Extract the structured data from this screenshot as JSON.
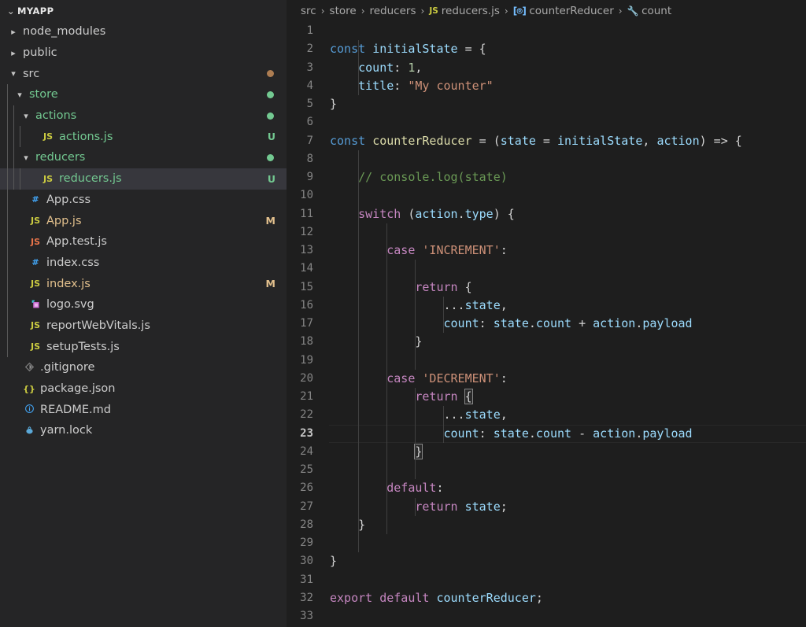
{
  "sidebar": {
    "header": {
      "label": "MYAPP",
      "twisty": "chevron-down-icon"
    },
    "items": [
      {
        "label": "node_modules",
        "indent": 1,
        "kind": "folder",
        "twisty": "collapsed",
        "icon": "",
        "icon_class": "",
        "text_class": "t-default",
        "status": "",
        "dot": ""
      },
      {
        "label": "public",
        "indent": 1,
        "kind": "folder",
        "twisty": "collapsed",
        "icon": "",
        "icon_class": "",
        "text_class": "t-default",
        "status": "",
        "dot": ""
      },
      {
        "label": "src",
        "indent": 1,
        "kind": "folder",
        "twisty": "expanded",
        "icon": "",
        "icon_class": "",
        "text_class": "t-default",
        "status": "",
        "dot": "mixed"
      },
      {
        "label": "store",
        "indent": 2,
        "kind": "folder",
        "twisty": "expanded",
        "icon": "",
        "icon_class": "",
        "text_class": "t-untracked",
        "status": "",
        "dot": "green"
      },
      {
        "label": "actions",
        "indent": 3,
        "kind": "folder",
        "twisty": "expanded",
        "icon": "",
        "icon_class": "",
        "text_class": "t-untracked",
        "status": "",
        "dot": "green"
      },
      {
        "label": "actions.js",
        "indent": 4,
        "kind": "file",
        "twisty": "none",
        "icon": "JS",
        "icon_class": "c-js",
        "text_class": "t-untracked",
        "status": "U",
        "dot": ""
      },
      {
        "label": "reducers",
        "indent": 3,
        "kind": "folder",
        "twisty": "expanded",
        "icon": "",
        "icon_class": "",
        "text_class": "t-untracked",
        "status": "",
        "dot": "green"
      },
      {
        "label": "reducers.js",
        "indent": 4,
        "kind": "file",
        "twisty": "none",
        "icon": "JS",
        "icon_class": "c-js",
        "text_class": "t-untracked",
        "status": "U",
        "dot": "",
        "selected": true
      },
      {
        "label": "App.css",
        "indent": 2,
        "kind": "file",
        "twisty": "none",
        "icon": "#",
        "icon_class": "c-css",
        "text_class": "t-default",
        "status": "",
        "dot": ""
      },
      {
        "label": "App.js",
        "indent": 2,
        "kind": "file",
        "twisty": "none",
        "icon": "JS",
        "icon_class": "c-js",
        "text_class": "t-modified",
        "status": "M",
        "dot": ""
      },
      {
        "label": "App.test.js",
        "indent": 2,
        "kind": "file",
        "twisty": "none",
        "icon": "JS",
        "icon_class": "c-jstest",
        "text_class": "t-default",
        "status": "",
        "dot": ""
      },
      {
        "label": "index.css",
        "indent": 2,
        "kind": "file",
        "twisty": "none",
        "icon": "#",
        "icon_class": "c-css",
        "text_class": "t-default",
        "status": "",
        "dot": ""
      },
      {
        "label": "index.js",
        "indent": 2,
        "kind": "file",
        "twisty": "none",
        "icon": "JS",
        "icon_class": "c-js",
        "text_class": "t-modified",
        "status": "M",
        "dot": ""
      },
      {
        "label": "logo.svg",
        "indent": 2,
        "kind": "file",
        "twisty": "none",
        "icon": "svg-icon",
        "icon_class": "c-svg",
        "text_class": "t-default",
        "status": "",
        "dot": ""
      },
      {
        "label": "reportWebVitals.js",
        "indent": 2,
        "kind": "file",
        "twisty": "none",
        "icon": "JS",
        "icon_class": "c-js",
        "text_class": "t-default",
        "status": "",
        "dot": ""
      },
      {
        "label": "setupTests.js",
        "indent": 2,
        "kind": "file",
        "twisty": "none",
        "icon": "JS",
        "icon_class": "c-js",
        "text_class": "t-default",
        "status": "",
        "dot": ""
      },
      {
        "label": ".gitignore",
        "indent": 1,
        "kind": "file",
        "twisty": "none",
        "icon": "git-icon",
        "icon_class": "c-git",
        "text_class": "t-default",
        "status": "",
        "dot": ""
      },
      {
        "label": "package.json",
        "indent": 1,
        "kind": "file",
        "twisty": "none",
        "icon": "{}",
        "icon_class": "c-json",
        "text_class": "t-default",
        "status": "",
        "dot": ""
      },
      {
        "label": "README.md",
        "indent": 1,
        "kind": "file",
        "twisty": "none",
        "icon": "info-icon",
        "icon_class": "c-md",
        "text_class": "t-default",
        "status": "",
        "dot": ""
      },
      {
        "label": "yarn.lock",
        "indent": 1,
        "kind": "file",
        "twisty": "none",
        "icon": "yarn-icon",
        "icon_class": "c-yarn",
        "text_class": "t-default",
        "status": "",
        "dot": ""
      }
    ]
  },
  "breadcrumbs": {
    "separator": "›",
    "items": [
      {
        "label": "src",
        "icon": ""
      },
      {
        "label": "store",
        "icon": ""
      },
      {
        "label": "reducers",
        "icon": ""
      },
      {
        "label": "reducers.js",
        "icon": "js-file-icon"
      },
      {
        "label": "counterReducer",
        "icon": "symbol-variable-icon"
      },
      {
        "label": "count",
        "icon": "symbol-property-icon"
      }
    ]
  },
  "editor": {
    "language": "javascript",
    "file_name": "reducers.js",
    "current_line": 23,
    "total_lines": 33,
    "lines": [
      {
        "n": 1,
        "tokens": []
      },
      {
        "n": 2,
        "tokens": [
          {
            "t": "const",
            "c": "k"
          },
          {
            "t": " ",
            "c": "pn"
          },
          {
            "t": "initialState",
            "c": "var"
          },
          {
            "t": " = {",
            "c": "pn"
          }
        ]
      },
      {
        "n": 3,
        "tokens": [
          {
            "t": "    ",
            "c": "pn"
          },
          {
            "t": "count",
            "c": "var"
          },
          {
            "t": ": ",
            "c": "pn"
          },
          {
            "t": "1",
            "c": "num"
          },
          {
            "t": ",",
            "c": "pn"
          }
        ]
      },
      {
        "n": 4,
        "tokens": [
          {
            "t": "    ",
            "c": "pn"
          },
          {
            "t": "title",
            "c": "var"
          },
          {
            "t": ": ",
            "c": "pn"
          },
          {
            "t": "\"My counter\"",
            "c": "str"
          }
        ]
      },
      {
        "n": 5,
        "tokens": [
          {
            "t": "}",
            "c": "pn"
          }
        ]
      },
      {
        "n": 6,
        "tokens": []
      },
      {
        "n": 7,
        "tokens": [
          {
            "t": "const",
            "c": "k"
          },
          {
            "t": " ",
            "c": "pn"
          },
          {
            "t": "counterReducer",
            "c": "fn"
          },
          {
            "t": " = (",
            "c": "pn"
          },
          {
            "t": "state",
            "c": "var"
          },
          {
            "t": " = ",
            "c": "pn"
          },
          {
            "t": "initialState",
            "c": "var"
          },
          {
            "t": ", ",
            "c": "pn"
          },
          {
            "t": "action",
            "c": "var"
          },
          {
            "t": ") => {",
            "c": "pn"
          }
        ]
      },
      {
        "n": 8,
        "tokens": []
      },
      {
        "n": 9,
        "tokens": [
          {
            "t": "    ",
            "c": "pn"
          },
          {
            "t": "// console.log(state)",
            "c": "cmt"
          }
        ]
      },
      {
        "n": 10,
        "tokens": []
      },
      {
        "n": 11,
        "tokens": [
          {
            "t": "    ",
            "c": "pn"
          },
          {
            "t": "switch",
            "c": "kc"
          },
          {
            "t": " (",
            "c": "pn"
          },
          {
            "t": "action",
            "c": "var"
          },
          {
            "t": ".",
            "c": "pn"
          },
          {
            "t": "type",
            "c": "var"
          },
          {
            "t": ") {",
            "c": "pn"
          }
        ]
      },
      {
        "n": 12,
        "tokens": []
      },
      {
        "n": 13,
        "tokens": [
          {
            "t": "        ",
            "c": "pn"
          },
          {
            "t": "case",
            "c": "kc"
          },
          {
            "t": " ",
            "c": "pn"
          },
          {
            "t": "'INCREMENT'",
            "c": "str"
          },
          {
            "t": ":",
            "c": "pn"
          }
        ]
      },
      {
        "n": 14,
        "tokens": []
      },
      {
        "n": 15,
        "tokens": [
          {
            "t": "            ",
            "c": "pn"
          },
          {
            "t": "return",
            "c": "kc"
          },
          {
            "t": " {",
            "c": "pn"
          }
        ]
      },
      {
        "n": 16,
        "tokens": [
          {
            "t": "                ",
            "c": "pn"
          },
          {
            "t": "...",
            "c": "pn"
          },
          {
            "t": "state",
            "c": "var"
          },
          {
            "t": ",",
            "c": "pn"
          }
        ]
      },
      {
        "n": 17,
        "tokens": [
          {
            "t": "                ",
            "c": "pn"
          },
          {
            "t": "count",
            "c": "var"
          },
          {
            "t": ": ",
            "c": "pn"
          },
          {
            "t": "state",
            "c": "var"
          },
          {
            "t": ".",
            "c": "pn"
          },
          {
            "t": "count",
            "c": "var"
          },
          {
            "t": " + ",
            "c": "pn"
          },
          {
            "t": "action",
            "c": "var"
          },
          {
            "t": ".",
            "c": "pn"
          },
          {
            "t": "payload",
            "c": "var"
          }
        ]
      },
      {
        "n": 18,
        "tokens": [
          {
            "t": "            ",
            "c": "pn"
          },
          {
            "t": "}",
            "c": "pn"
          }
        ]
      },
      {
        "n": 19,
        "tokens": []
      },
      {
        "n": 20,
        "tokens": [
          {
            "t": "        ",
            "c": "pn"
          },
          {
            "t": "case",
            "c": "kc"
          },
          {
            "t": " ",
            "c": "pn"
          },
          {
            "t": "'DECREMENT'",
            "c": "str"
          },
          {
            "t": ":",
            "c": "pn"
          }
        ]
      },
      {
        "n": 21,
        "tokens": [
          {
            "t": "            ",
            "c": "pn"
          },
          {
            "t": "return",
            "c": "kc"
          },
          {
            "t": " ",
            "c": "pn"
          },
          {
            "t": "{",
            "c": "pn",
            "bracket_match": true
          }
        ]
      },
      {
        "n": 22,
        "tokens": [
          {
            "t": "                ",
            "c": "pn"
          },
          {
            "t": "...",
            "c": "pn"
          },
          {
            "t": "state",
            "c": "var"
          },
          {
            "t": ",",
            "c": "pn"
          }
        ]
      },
      {
        "n": 23,
        "tokens": [
          {
            "t": "                ",
            "c": "pn"
          },
          {
            "t": "count",
            "c": "var"
          },
          {
            "t": ": ",
            "c": "pn"
          },
          {
            "t": "state",
            "c": "var"
          },
          {
            "t": ".",
            "c": "pn"
          },
          {
            "t": "count",
            "c": "var"
          },
          {
            "t": " - ",
            "c": "pn"
          },
          {
            "t": "action",
            "c": "var"
          },
          {
            "t": ".",
            "c": "pn"
          },
          {
            "t": "payload",
            "c": "var"
          }
        ],
        "current": true
      },
      {
        "n": 24,
        "tokens": [
          {
            "t": "            ",
            "c": "pn"
          },
          {
            "t": "}",
            "c": "pn",
            "bracket_match": true
          }
        ]
      },
      {
        "n": 25,
        "tokens": []
      },
      {
        "n": 26,
        "tokens": [
          {
            "t": "        ",
            "c": "pn"
          },
          {
            "t": "default",
            "c": "kc"
          },
          {
            "t": ":",
            "c": "pn"
          }
        ]
      },
      {
        "n": 27,
        "tokens": [
          {
            "t": "            ",
            "c": "pn"
          },
          {
            "t": "return",
            "c": "kc"
          },
          {
            "t": " ",
            "c": "pn"
          },
          {
            "t": "state",
            "c": "var"
          },
          {
            "t": ";",
            "c": "pn"
          }
        ]
      },
      {
        "n": 28,
        "tokens": [
          {
            "t": "    ",
            "c": "pn"
          },
          {
            "t": "}",
            "c": "pn"
          }
        ]
      },
      {
        "n": 29,
        "tokens": []
      },
      {
        "n": 30,
        "tokens": [
          {
            "t": "}",
            "c": "pn"
          }
        ]
      },
      {
        "n": 31,
        "tokens": []
      },
      {
        "n": 32,
        "tokens": [
          {
            "t": "export",
            "c": "kc"
          },
          {
            "t": " ",
            "c": "pn"
          },
          {
            "t": "default",
            "c": "kc"
          },
          {
            "t": " ",
            "c": "pn"
          },
          {
            "t": "counterReducer",
            "c": "var"
          },
          {
            "t": ";",
            "c": "pn"
          }
        ]
      },
      {
        "n": 33,
        "tokens": []
      }
    ],
    "indent_guides": {
      "2": [
        1
      ],
      "3": [
        1
      ],
      "4": [
        1
      ],
      "7": [],
      "8": [
        1
      ],
      "9": [
        1
      ],
      "10": [
        1
      ],
      "11": [
        1
      ],
      "12": [
        1,
        2
      ],
      "13": [
        1,
        2
      ],
      "14": [
        1,
        2,
        3
      ],
      "15": [
        1,
        2,
        3
      ],
      "16": [
        1,
        2,
        3,
        4
      ],
      "17": [
        1,
        2,
        3,
        4
      ],
      "18": [
        1,
        2,
        3
      ],
      "19": [
        1,
        2,
        3
      ],
      "20": [
        1,
        2
      ],
      "21": [
        1,
        2,
        3
      ],
      "22": [
        1,
        2,
        3,
        4
      ],
      "23": [
        1,
        2,
        3,
        4
      ],
      "24": [
        1,
        2,
        3
      ],
      "25": [
        1,
        2,
        3
      ],
      "26": [
        1,
        2
      ],
      "27": [
        1,
        2,
        3
      ],
      "28": [
        1,
        2
      ],
      "29": [
        1
      ]
    }
  },
  "colors": {
    "sidebar_bg": "#252526",
    "editor_bg": "#1e1e1e",
    "selection_bg": "#37373d",
    "keyword": "#569cd6",
    "control_keyword": "#c586c0",
    "variable": "#9cdcfe",
    "function": "#dcdcaa",
    "string": "#ce9178",
    "number": "#b5cea8",
    "comment": "#6a9955",
    "untracked_green": "#73c991",
    "modified_amber": "#e2c08d"
  }
}
